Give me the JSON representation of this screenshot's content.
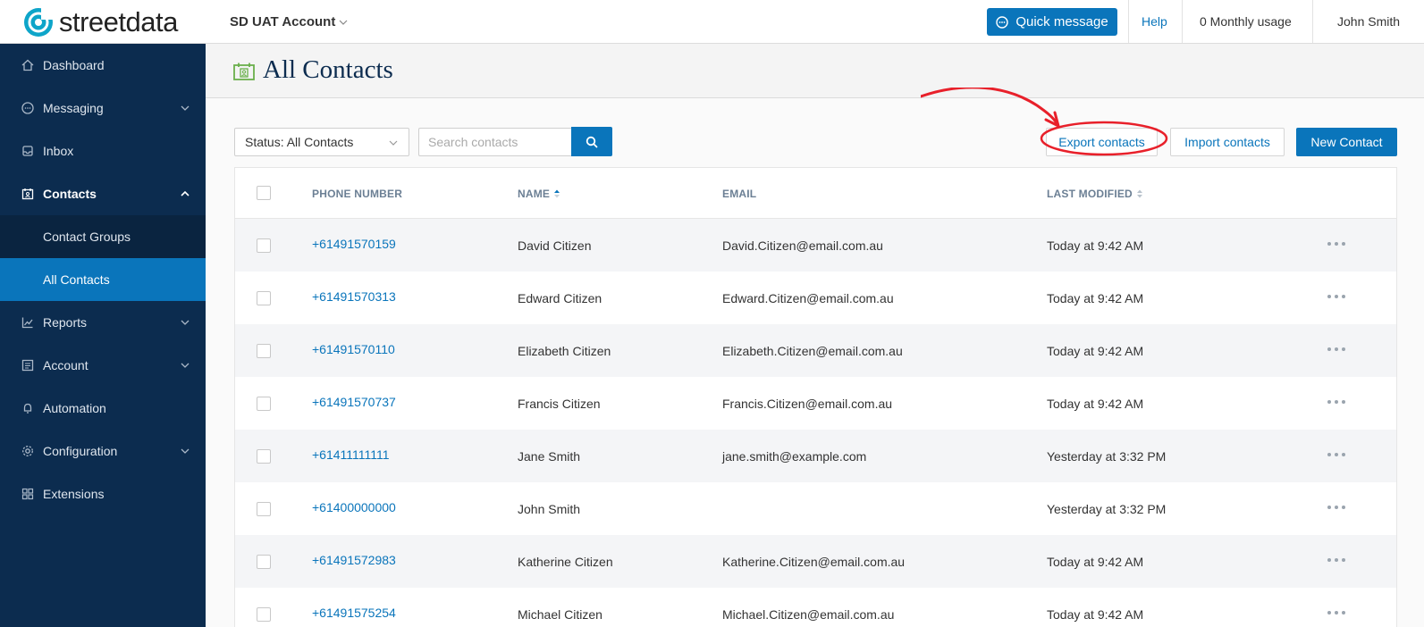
{
  "brand": {
    "name": "streetdata",
    "accent": "#0a75bb",
    "navy": "#0c2c4f"
  },
  "header": {
    "account": "SD UAT Account",
    "quick_message": "Quick message",
    "help": "Help",
    "usage": "0 Monthly usage",
    "user": "John Smith"
  },
  "sidebar": {
    "items": [
      {
        "label": "Dashboard",
        "icon": "home-icon"
      },
      {
        "label": "Messaging",
        "icon": "chat-icon"
      },
      {
        "label": "Inbox",
        "icon": "inbox-icon"
      },
      {
        "label": "Contacts",
        "icon": "contacts-icon"
      },
      {
        "label": "Contact Groups"
      },
      {
        "label": "All Contacts"
      },
      {
        "label": "Reports",
        "icon": "chart-icon"
      },
      {
        "label": "Account",
        "icon": "account-icon"
      },
      {
        "label": "Automation",
        "icon": "bell-icon"
      },
      {
        "label": "Configuration",
        "icon": "gear-icon"
      },
      {
        "label": "Extensions",
        "icon": "grid-icon"
      }
    ]
  },
  "page": {
    "title": "All Contacts"
  },
  "toolbar": {
    "status_filter": "Status: All Contacts",
    "search_placeholder": "Search contacts",
    "export": "Export contacts",
    "import": "Import contacts",
    "new_contact": "New Contact"
  },
  "table": {
    "columns": [
      "PHONE NUMBER",
      "NAME",
      "EMAIL",
      "LAST MODIFIED"
    ],
    "rows": [
      {
        "phone": "+61491570159",
        "name": "David Citizen",
        "email": "David.Citizen@email.com.au",
        "modified": "Today at 9:42 AM"
      },
      {
        "phone": "+61491570313",
        "name": "Edward Citizen",
        "email": "Edward.Citizen@email.com.au",
        "modified": "Today at 9:42 AM"
      },
      {
        "phone": "+61491570110",
        "name": "Elizabeth Citizen",
        "email": "Elizabeth.Citizen@email.com.au",
        "modified": "Today at 9:42 AM"
      },
      {
        "phone": "+61491570737",
        "name": "Francis Citizen",
        "email": "Francis.Citizen@email.com.au",
        "modified": "Today at 9:42 AM"
      },
      {
        "phone": "+61411111111",
        "name": "Jane Smith",
        "email": "jane.smith@example.com",
        "modified": "Yesterday at 3:32 PM"
      },
      {
        "phone": "+61400000000",
        "name": "John Smith",
        "email": "",
        "modified": "Yesterday at 3:32 PM"
      },
      {
        "phone": "+61491572983",
        "name": "Katherine Citizen",
        "email": "Katherine.Citizen@email.com.au",
        "modified": "Today at 9:42 AM"
      },
      {
        "phone": "+61491575254",
        "name": "Michael Citizen",
        "email": "Michael.Citizen@email.com.au",
        "modified": "Today at 9:42 AM"
      }
    ]
  }
}
